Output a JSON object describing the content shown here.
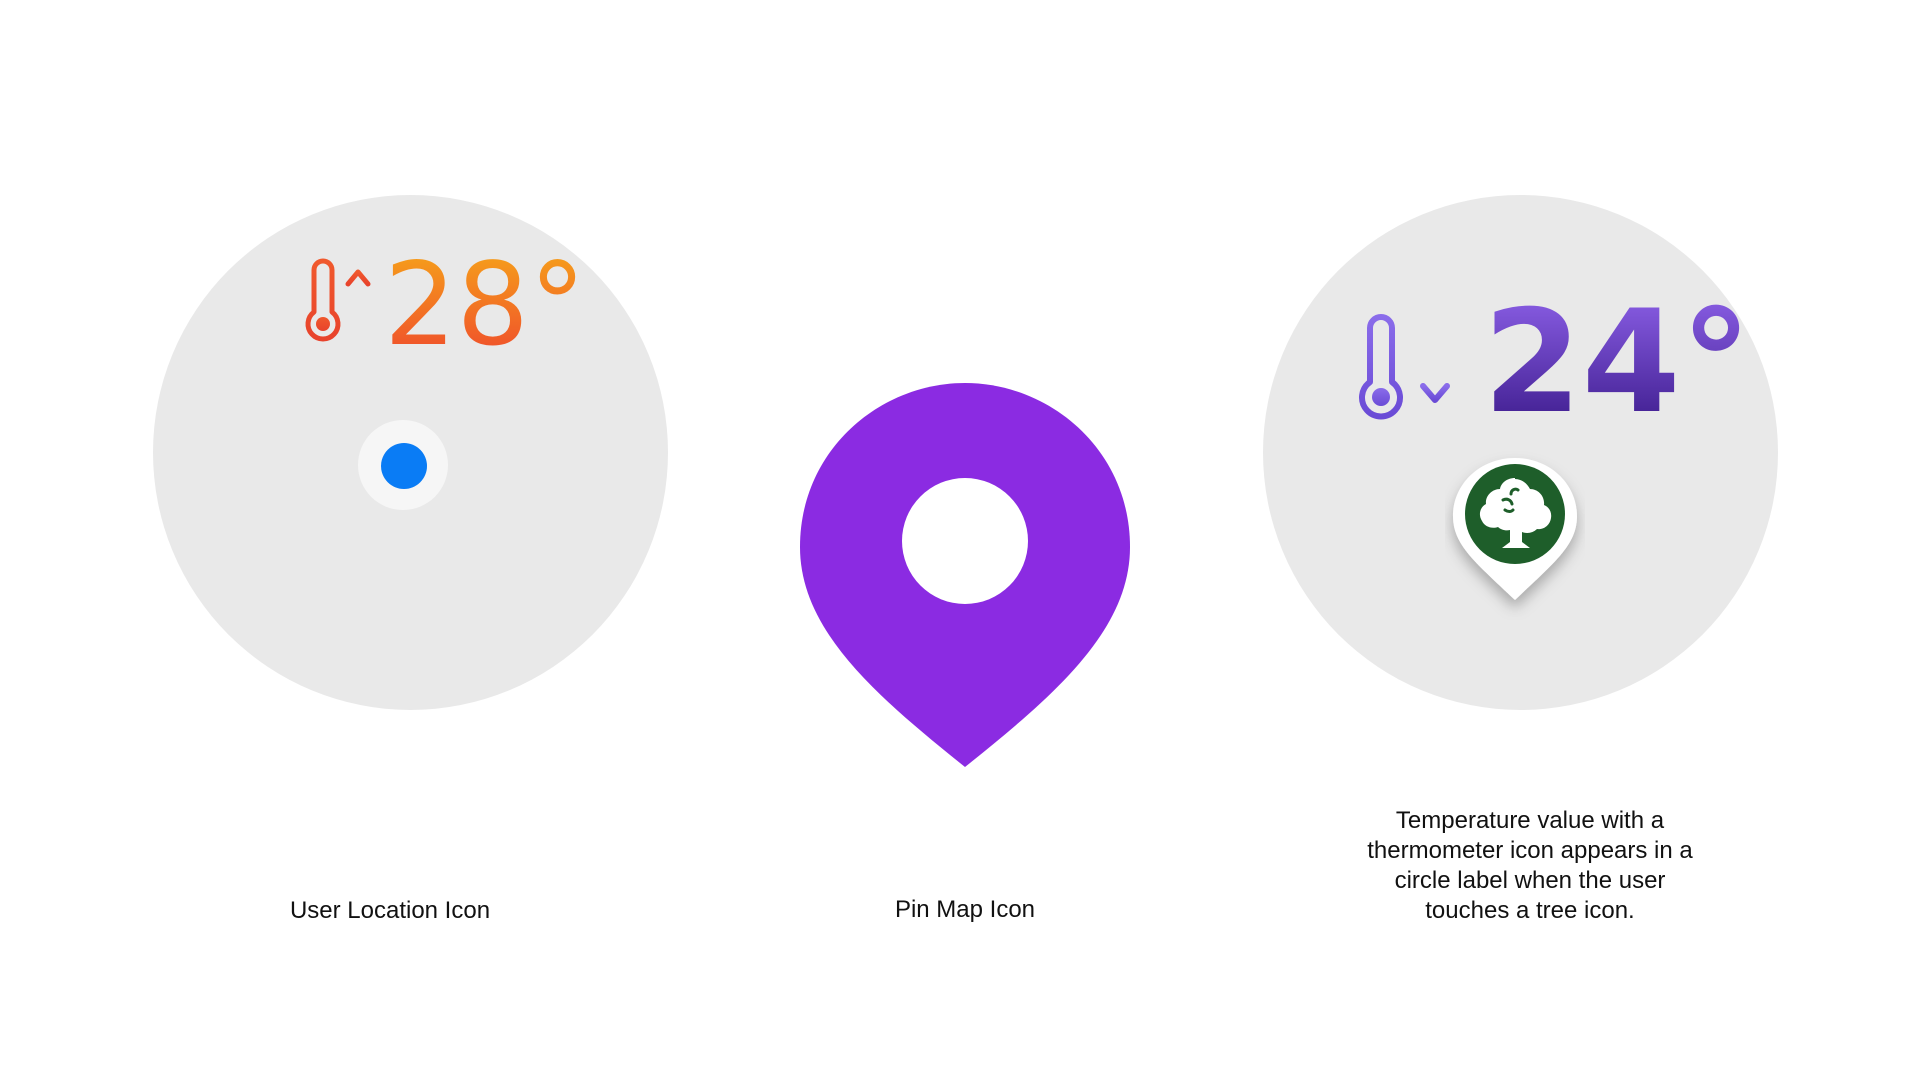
{
  "left_panel": {
    "temperature": "28°",
    "trend": "up",
    "caption": "User Location Icon",
    "colors": {
      "gradient_top": "#f6a21a",
      "gradient_bottom": "#ef4a2c",
      "user_dot": "#0a7cf5",
      "circle_bg": "#e9e9e9"
    },
    "icons": [
      "thermometer-icon",
      "arrow-up-icon",
      "user-location-dot-icon"
    ]
  },
  "center_panel": {
    "caption": "Pin Map Icon",
    "colors": {
      "pin": "#8b2be2",
      "pin_hole": "#ffffff"
    },
    "icons": [
      "map-pin-icon"
    ]
  },
  "right_panel": {
    "temperature": "24°",
    "trend": "down",
    "caption": "Temperature value with a thermometer icon appears in a circle label when the user touches a tree icon.",
    "colors": {
      "gradient_top": "#8b5fe6",
      "gradient_bottom": "#3b1a8a",
      "thermometer": "#7a5ce0",
      "tree_bg": "#1e5e2a",
      "circle_bg": "#e9e9e9"
    },
    "icons": [
      "thermometer-icon",
      "arrow-down-icon",
      "tree-marker-icon"
    ]
  }
}
